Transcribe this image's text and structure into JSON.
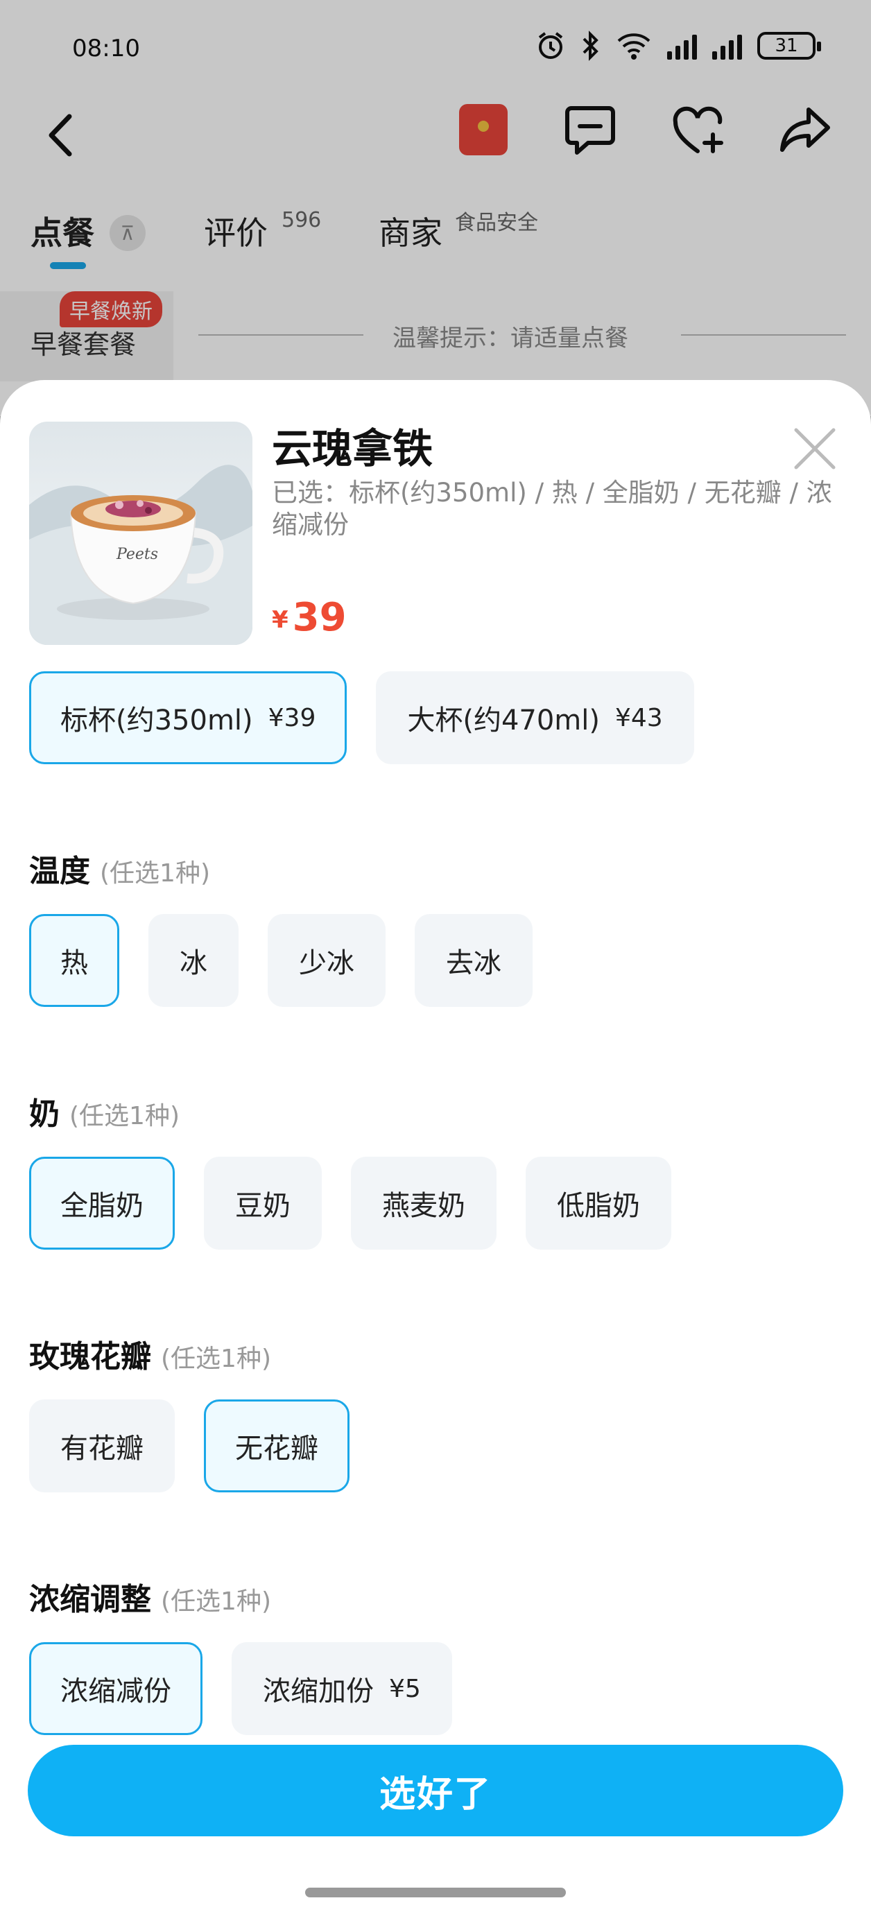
{
  "status_bar": {
    "time": "08:10",
    "battery": "31"
  },
  "tabs": [
    {
      "label": "点餐",
      "sup": ""
    },
    {
      "label": "评价",
      "sup": "596"
    },
    {
      "label": "商家",
      "sup": "食品安全"
    }
  ],
  "pin_glyph": "⊼",
  "category": {
    "badge": "早餐焕新",
    "label": "早餐套餐",
    "hint": "温馨提示：请适量点餐"
  },
  "product": {
    "name": "云瑰拿铁",
    "selected_text": "已选：标杯(约350ml) / 热 / 全脂奶 / 无花瓣 / 浓缩减份",
    "currency": "¥",
    "price": "39",
    "image_brand": "Peets"
  },
  "sizes": [
    {
      "label": "标杯(约350ml)",
      "price": "¥39",
      "selected": true
    },
    {
      "label": "大杯(约470ml)",
      "price": "¥43",
      "selected": false
    }
  ],
  "groups": [
    {
      "title": "温度",
      "sub": "(任选1种)",
      "options": [
        {
          "label": "热",
          "selected": true
        },
        {
          "label": "冰",
          "selected": false
        },
        {
          "label": "少冰",
          "selected": false
        },
        {
          "label": "去冰",
          "selected": false
        }
      ]
    },
    {
      "title": "奶",
      "sub": "(任选1种)",
      "options": [
        {
          "label": "全脂奶",
          "selected": true
        },
        {
          "label": "豆奶",
          "selected": false
        },
        {
          "label": "燕麦奶",
          "selected": false
        },
        {
          "label": "低脂奶",
          "selected": false
        }
      ]
    },
    {
      "title": "玫瑰花瓣",
      "sub": "(任选1种)",
      "options": [
        {
          "label": "有花瓣",
          "selected": false
        },
        {
          "label": "无花瓣",
          "selected": true
        }
      ]
    },
    {
      "title": "浓缩调整",
      "sub": "(任选1种)",
      "options": [
        {
          "label": "浓缩减份",
          "price": "",
          "selected": true
        },
        {
          "label": "浓缩加份",
          "price": "¥5",
          "selected": false
        }
      ]
    }
  ],
  "confirm_label": "选好了",
  "colors": {
    "accent": "#0fb1f5",
    "price": "#ee4b33",
    "selected_border": "#1aa7e8",
    "badge": "#e8453a"
  }
}
